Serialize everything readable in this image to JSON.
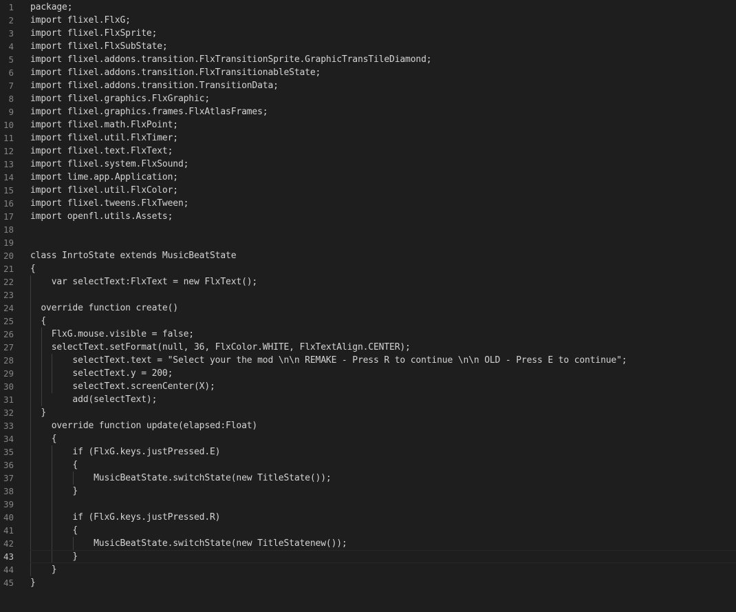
{
  "editor": {
    "active_line": 43,
    "lines": [
      {
        "num": "1",
        "text": "package;"
      },
      {
        "num": "2",
        "text": "import flixel.FlxG;"
      },
      {
        "num": "3",
        "text": "import flixel.FlxSprite;"
      },
      {
        "num": "4",
        "text": "import flixel.FlxSubState;"
      },
      {
        "num": "5",
        "text": "import flixel.addons.transition.FlxTransitionSprite.GraphicTransTileDiamond;"
      },
      {
        "num": "6",
        "text": "import flixel.addons.transition.FlxTransitionableState;"
      },
      {
        "num": "7",
        "text": "import flixel.addons.transition.TransitionData;"
      },
      {
        "num": "8",
        "text": "import flixel.graphics.FlxGraphic;"
      },
      {
        "num": "9",
        "text": "import flixel.graphics.frames.FlxAtlasFrames;"
      },
      {
        "num": "10",
        "text": "import flixel.math.FlxPoint;"
      },
      {
        "num": "11",
        "text": "import flixel.util.FlxTimer;"
      },
      {
        "num": "12",
        "text": "import flixel.text.FlxText;"
      },
      {
        "num": "13",
        "text": "import flixel.system.FlxSound;"
      },
      {
        "num": "14",
        "text": "import lime.app.Application;"
      },
      {
        "num": "15",
        "text": "import flixel.util.FlxColor;"
      },
      {
        "num": "16",
        "text": "import flixel.tweens.FlxTween;"
      },
      {
        "num": "17",
        "text": "import openfl.utils.Assets;"
      },
      {
        "num": "18",
        "text": ""
      },
      {
        "num": "19",
        "text": ""
      },
      {
        "num": "20",
        "text": "class InrtoState extends MusicBeatState"
      },
      {
        "num": "21",
        "text": "{"
      },
      {
        "num": "22",
        "text": "    var selectText:FlxText = new FlxText();"
      },
      {
        "num": "23",
        "text": ""
      },
      {
        "num": "24",
        "text": "  override function create()"
      },
      {
        "num": "25",
        "text": "  {"
      },
      {
        "num": "26",
        "text": "    FlxG.mouse.visible = false;"
      },
      {
        "num": "27",
        "text": "    selectText.setFormat(null, 36, FlxColor.WHITE, FlxTextAlign.CENTER);"
      },
      {
        "num": "28",
        "text": "        selectText.text = \"Select your the mod \\n\\n REMAKE - Press R to continue \\n\\n OLD - Press E to continue\";"
      },
      {
        "num": "29",
        "text": "        selectText.y = 200;"
      },
      {
        "num": "30",
        "text": "        selectText.screenCenter(X);"
      },
      {
        "num": "31",
        "text": "        add(selectText);"
      },
      {
        "num": "32",
        "text": "  }"
      },
      {
        "num": "33",
        "text": "    override function update(elapsed:Float)"
      },
      {
        "num": "34",
        "text": "    {"
      },
      {
        "num": "35",
        "text": "        if (FlxG.keys.justPressed.E)"
      },
      {
        "num": "36",
        "text": "        {"
      },
      {
        "num": "37",
        "text": "            MusicBeatState.switchState(new TitleState());"
      },
      {
        "num": "38",
        "text": "        }"
      },
      {
        "num": "39",
        "text": ""
      },
      {
        "num": "40",
        "text": "        if (FlxG.keys.justPressed.R)"
      },
      {
        "num": "41",
        "text": "        {"
      },
      {
        "num": "42",
        "text": "            MusicBeatState.switchState(new TitleStatenew());"
      },
      {
        "num": "43",
        "text": "        }"
      },
      {
        "num": "44",
        "text": "    }"
      },
      {
        "num": "45",
        "text": "}"
      }
    ]
  }
}
